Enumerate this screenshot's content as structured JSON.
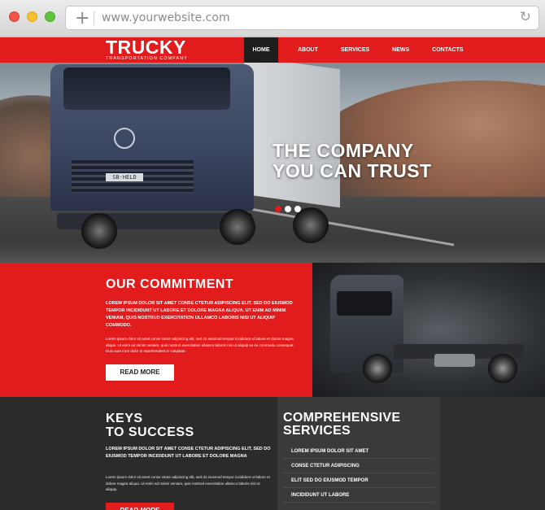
{
  "browser": {
    "url": "www.yourwebsite.com",
    "plus_glyph": "+",
    "reload_glyph": "↻"
  },
  "header": {
    "logo": "TRUCKY",
    "tagline": "TRANSPORTATION COMPANY",
    "nav": [
      "HOME",
      "ABOUT",
      "SERVICES",
      "NEWS",
      "CONTACTS"
    ],
    "active": "HOME"
  },
  "hero": {
    "title_line1": "THE COMPANY",
    "title_line2": "YOU CAN TRUST",
    "plate": "SB·HELD",
    "slides": 3,
    "active_slide": 1
  },
  "commitment": {
    "title": "OUR COMMITMENT",
    "bold_text": "LOREM IPSUM DOLOR SIT AMET CONSE CTETUR ADIPISCING ELIT, SED DO EIUSMOD TEMPOR INCIDIDUNT UT LABORE ET DOLORE MAGNA ALIQUA. UT ENIM AD MINIM VENIAM, QUIS NOSTRUD EXERCITATION ULLAMCO LABORIS NISI UT ALIQUIP COMMODO.",
    "small_text": "Lorem ipsum dolor sit amet conse ctetur adipiscing elit, sed do eiusmod tempor incididunt ut labore et dolore magna aliqua. Ut enim ad minim veniam, quis nostrud exercitation ullamco laboris nisi ut aliquip ex ea commodo consequat. Duis aute irure dolor in reprehenderit in voluptate.",
    "button": "READ MORE"
  },
  "keys": {
    "title_line1": "KEYS",
    "title_line2": "TO SUCCESS",
    "bold_text": "LOREM IPSUM DOLOR SIT AMET CONSE CTETUR ADIPISCING ELIT, SED DO EIUSMOD TEMPOR INCIDIDUNT UT LABORE ET DOLORE MAGNA",
    "small_text": "Lorem ipsum dolor sit amet conse ctetur adipiscing elit, sed do eiusmod tempor incididunt ut labore et dolore magna aliqua. Ut enim ad minim veniam, quis nostrud exercitation ullamco laboris nisi ut aliquip.",
    "button": "READ MORE"
  },
  "services": {
    "title_line1": "COMPREHENSIVE",
    "title_line2": "SERVICES",
    "items": [
      "LOREM IPSUM DOLOR SIT AMET",
      "CONSE CTETUR ADIPISCING",
      "ELIT SED DO EIUSMOD TEMPOR",
      "INCIDIDUNT UT LABORE"
    ]
  },
  "colors": {
    "brand_red": "#e21c1c",
    "dark": "#2b2b2b",
    "nav_active": "#1e1e1e"
  }
}
